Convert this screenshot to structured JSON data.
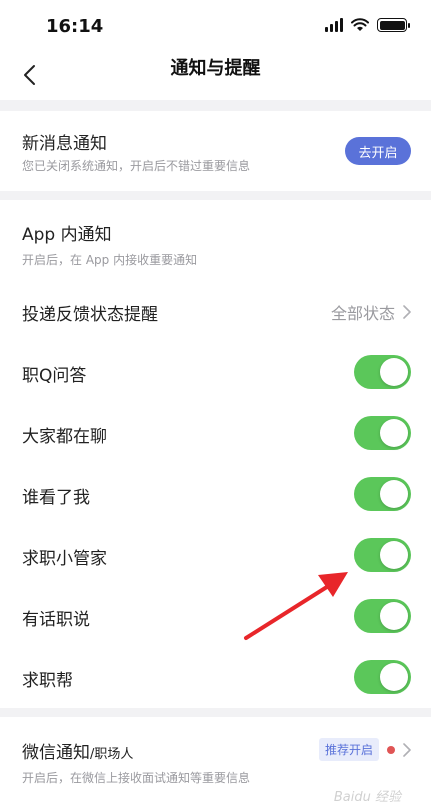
{
  "status_bar": {
    "time": "16:14"
  },
  "nav": {
    "title": "通知与提醒"
  },
  "new_message": {
    "title": "新消息通知",
    "subtitle": "您已关闭系统通知，开启后不错过重要信息",
    "button": "去开启"
  },
  "in_app": {
    "title": "App 内通知",
    "subtitle": "开启后，在 App 内接收重要通知"
  },
  "delivery_feedback": {
    "title": "投递反馈状态提醒",
    "value": "全部状态"
  },
  "toggles": [
    {
      "label": "职Q问答",
      "on": true
    },
    {
      "label": "大家都在聊",
      "on": true
    },
    {
      "label": "谁看了我",
      "on": true
    },
    {
      "label": "求职小管家",
      "on": true
    },
    {
      "label": "有话职说",
      "on": true
    },
    {
      "label": "求职帮",
      "on": true
    }
  ],
  "wechat": {
    "title": "微信通知",
    "title_suffix": "/职场人",
    "subtitle": "开启后，在微信上接收面试通知等重要信息",
    "tag": "推荐开启"
  },
  "watermark": "Baidu 经验",
  "colors": {
    "toggle_on": "#5bc75a",
    "accent": "#5a72d9",
    "arrow": "#e8262a"
  }
}
